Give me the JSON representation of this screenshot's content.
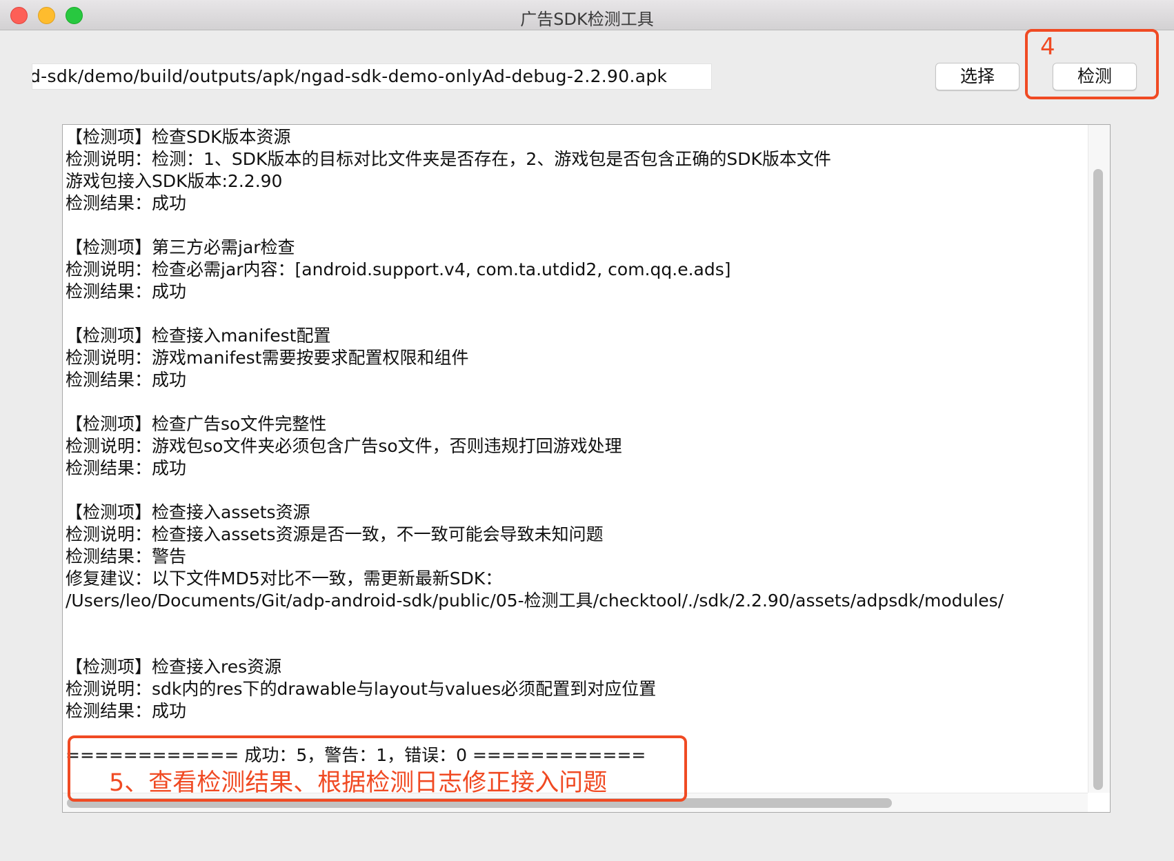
{
  "window": {
    "title": "广告SDK检测工具"
  },
  "toolbar": {
    "apk_path": "d-sdk/demo/build/outputs/apk/ngad-sdk-demo-onlyAd-debug-2.2.90.apk",
    "select_label": "选择",
    "check_label": "检测"
  },
  "log": {
    "lines": [
      "【检测项】检查SDK版本资源",
      "检测说明：检测：1、SDK版本的目标对比文件夹是否存在，2、游戏包是否包含正确的SDK版本文件",
      " 游戏包接入SDK版本:2.2.90",
      "检测结果：成功",
      "",
      "【检测项】第三方必需jar检查",
      "检测说明：检查必需jar内容：[android.support.v4, com.ta.utdid2, com.qq.e.ads]",
      "检测结果：成功",
      "",
      "【检测项】检查接入manifest配置",
      "检测说明：游戏manifest需要按要求配置权限和组件",
      "检测结果：成功",
      "",
      "【检测项】检查广告so文件完整性",
      "检测说明：游戏包so文件夹必须包含广告so文件，否则违规打回游戏处理",
      "检测结果：成功",
      "",
      "【检测项】检查接入assets资源",
      "检测说明：检查接入assets资源是否一致，不一致可能会导致未知问题",
      "检测结果：警告",
      "修复建议：以下文件MD5对比不一致，需更新最新SDK：",
      "/Users/leo/Documents/Git/adp-android-sdk/public/05-检测工具/checktool/./sdk/2.2.90/assets/adpsdk/modules/",
      "",
      "",
      "【检测项】检查接入res资源",
      "检测说明：sdk内的res下的drawable与layout与values必须配置到对应位置",
      "检测结果：成功",
      "",
      "============ 成功：5，警告：1，错误：0 ============"
    ]
  },
  "annotations": {
    "step4": "4",
    "step5": "5、查看检测结果、根据检测日志修正接入问题",
    "color": "#f04a23"
  }
}
